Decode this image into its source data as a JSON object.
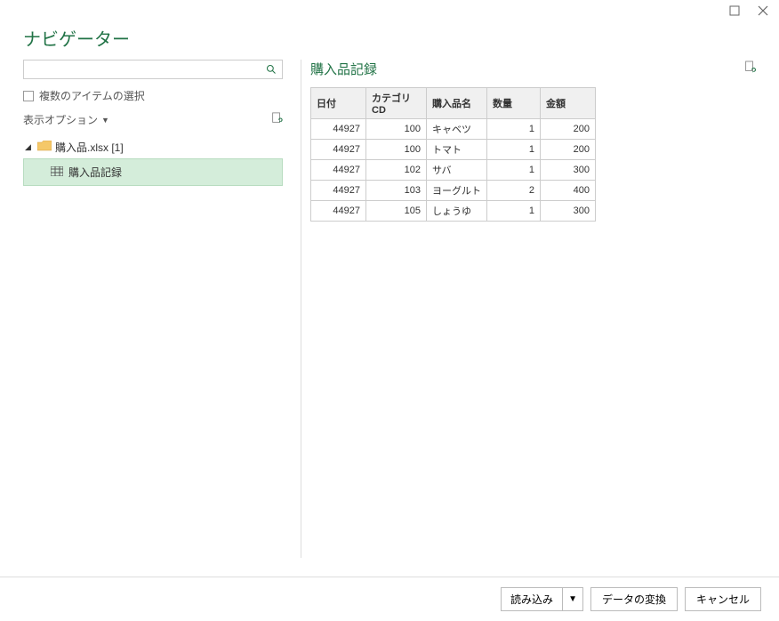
{
  "header": {
    "title": "ナビゲーター"
  },
  "search": {
    "placeholder": ""
  },
  "multiselect": {
    "label": "複数のアイテムの選択"
  },
  "display_options": {
    "label": "表示オプション"
  },
  "tree": {
    "root": {
      "label": "購入品.xlsx [1]"
    },
    "child": {
      "label": "購入品記録"
    }
  },
  "preview": {
    "title": "購入品記録",
    "columns": [
      "日付",
      "カテゴリCD",
      "購入品名",
      "数量",
      "金額"
    ],
    "rows": [
      {
        "date": "44927",
        "cat": "100",
        "name": "キャベツ",
        "qty": "1",
        "amt": "200"
      },
      {
        "date": "44927",
        "cat": "100",
        "name": "トマト",
        "qty": "1",
        "amt": "200"
      },
      {
        "date": "44927",
        "cat": "102",
        "name": "サバ",
        "qty": "1",
        "amt": "300"
      },
      {
        "date": "44927",
        "cat": "103",
        "name": "ヨーグルト",
        "qty": "2",
        "amt": "400"
      },
      {
        "date": "44927",
        "cat": "105",
        "name": "しょうゆ",
        "qty": "1",
        "amt": "300"
      }
    ]
  },
  "footer": {
    "load": "読み込み",
    "transform": "データの変換",
    "cancel": "キャンセル"
  }
}
